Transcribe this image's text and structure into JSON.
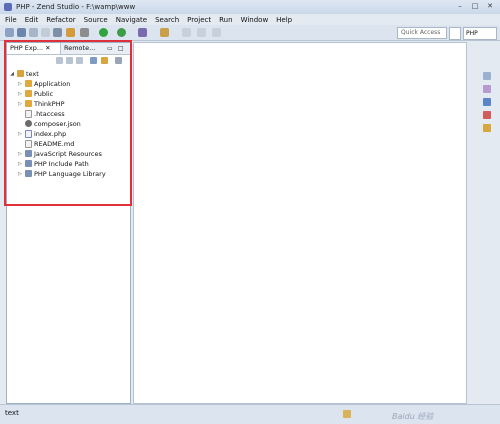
{
  "window": {
    "title": "PHP - Zend Studio - F:\\wamp\\www",
    "minimize": "–",
    "maximize": "□",
    "close": "✕"
  },
  "menu": [
    "File",
    "Edit",
    "Refactor",
    "Source",
    "Navigate",
    "Search",
    "Project",
    "Run",
    "Window",
    "Help"
  ],
  "toolbar": {
    "quick_access": "Quick Access",
    "perspective": "PHP"
  },
  "explorer": {
    "tabs": [
      {
        "label": "PHP Exp..."
      },
      {
        "label": "Remote..."
      }
    ],
    "tree": {
      "root": "text",
      "items": [
        {
          "label": "Application"
        },
        {
          "label": "Public"
        },
        {
          "label": "ThinkPHP"
        },
        {
          "label": ".htaccess"
        },
        {
          "label": "composer.json"
        },
        {
          "label": "index.php"
        },
        {
          "label": "README.md"
        },
        {
          "label": "JavaScript Resources"
        },
        {
          "label": "PHP Include Path"
        },
        {
          "label": "PHP Language Library"
        }
      ]
    }
  },
  "status": {
    "text": "text"
  },
  "watermark": "Baidu 经验"
}
